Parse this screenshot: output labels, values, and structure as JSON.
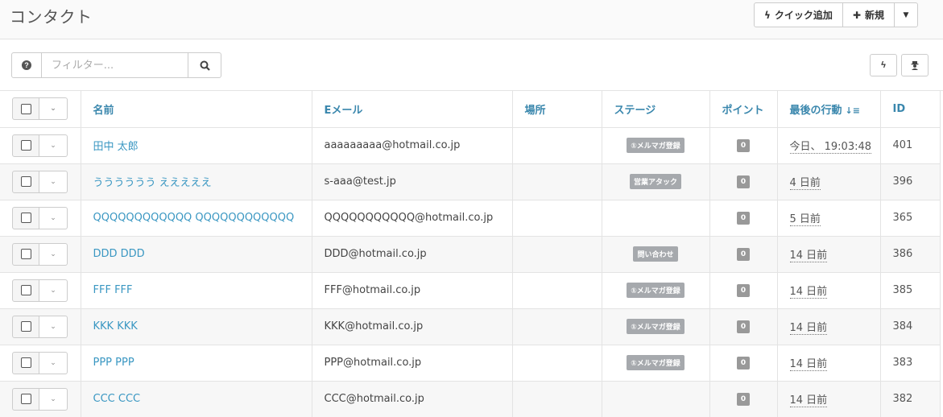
{
  "header": {
    "title": "コンタクト",
    "quick_add_label": "クイック追加",
    "new_label": "新規"
  },
  "toolbar": {
    "filter_placeholder": "フィルター..."
  },
  "table": {
    "columns": {
      "name": "名前",
      "email": "Eメール",
      "location": "場所",
      "stage": "ステージ",
      "points": "ポイント",
      "last_active": "最後の行動",
      "id": "ID"
    },
    "rows": [
      {
        "name": "田中 太郎",
        "email": "aaaaaaaaa@hotmail.co.jp",
        "location": "",
        "stage": "①メルマガ登録",
        "points": "0",
        "last_active": "今日、 19:03:48",
        "id": "401"
      },
      {
        "name": "うううううう えええええ",
        "email": "s-aaa@test.jp",
        "location": "",
        "stage": "営業アタック",
        "points": "0",
        "last_active": "4 日前",
        "id": "396"
      },
      {
        "name": "QQQQQQQQQQQQ QQQQQQQQQQQQ",
        "email": "QQQQQQQQQQQ@hotmail.co.jp",
        "location": "",
        "stage": "",
        "points": "0",
        "last_active": "5 日前",
        "id": "365"
      },
      {
        "name": "DDD DDD",
        "email": "DDD@hotmail.co.jp",
        "location": "",
        "stage": "問い合わせ",
        "points": "0",
        "last_active": "14 日前",
        "id": "386"
      },
      {
        "name": "FFF FFF",
        "email": "FFF@hotmail.co.jp",
        "location": "",
        "stage": "①メルマガ登録",
        "points": "0",
        "last_active": "14 日前",
        "id": "385"
      },
      {
        "name": "KKK KKK",
        "email": "KKK@hotmail.co.jp",
        "location": "",
        "stage": "①メルマガ登録",
        "points": "0",
        "last_active": "14 日前",
        "id": "384"
      },
      {
        "name": "PPP PPP",
        "email": "PPP@hotmail.co.jp",
        "location": "",
        "stage": "①メルマガ登録",
        "points": "0",
        "last_active": "14 日前",
        "id": "383"
      },
      {
        "name": "CCC CCC",
        "email": "CCC@hotmail.co.jp",
        "location": "",
        "stage": "",
        "points": "0",
        "last_active": "14 日前",
        "id": "382"
      }
    ]
  },
  "colors": {
    "link": "#3a97c2",
    "header_text": "#3a87ad",
    "stage_badge": "#a6a9ad",
    "points_badge": "#999999"
  }
}
